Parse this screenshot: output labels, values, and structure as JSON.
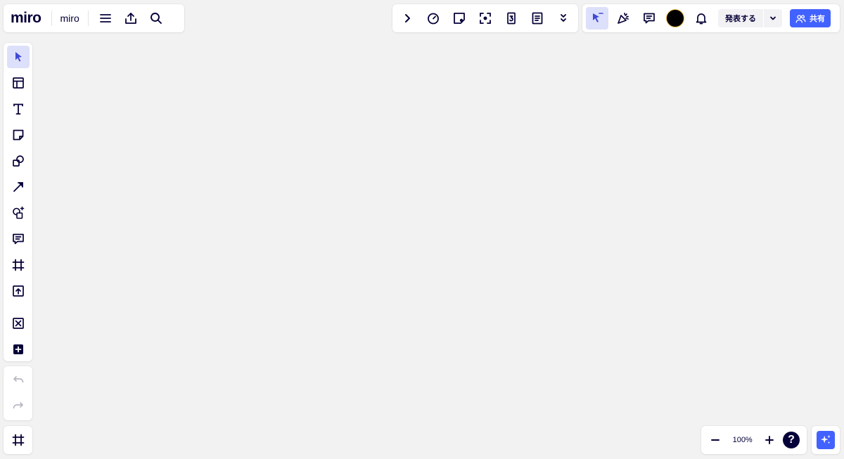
{
  "header": {
    "logo_text": "miro",
    "board_name": "miro"
  },
  "top_right": {
    "present_label": "発表する",
    "share_label": "共有"
  },
  "zoom": {
    "level": "100%"
  },
  "help": {
    "label": "?"
  },
  "icons": {
    "top_left": [
      "menu-icon",
      "export-icon",
      "search-icon"
    ],
    "top_center": [
      "expand-icon",
      "timer-icon",
      "sticker-icon",
      "focus-icon",
      "counter-icon",
      "notes-icon",
      "more-icon"
    ],
    "top_right": [
      "cursor-icon",
      "reactions-icon",
      "comments-icon",
      "avatar",
      "bell-icon",
      "chevron-down-icon",
      "users-icon"
    ],
    "left_toolbar": [
      "select-icon",
      "templates-icon",
      "text-icon",
      "sticky-note-icon",
      "shapes-icon",
      "line-icon",
      "diagram-icon",
      "comment-icon",
      "frame-icon",
      "upload-icon",
      "apps-icon",
      "add-icon"
    ],
    "history": [
      "undo-icon",
      "redo-icon"
    ],
    "bottom": [
      "frames-list-icon",
      "zoom-out-icon",
      "zoom-in-icon",
      "help-icon",
      "ai-sparkle-icon"
    ]
  },
  "colors": {
    "canvas": "#f2f2f2",
    "accent": "#4262ff",
    "active_tool_bg": "#dde0fa",
    "ink": "#050038"
  }
}
